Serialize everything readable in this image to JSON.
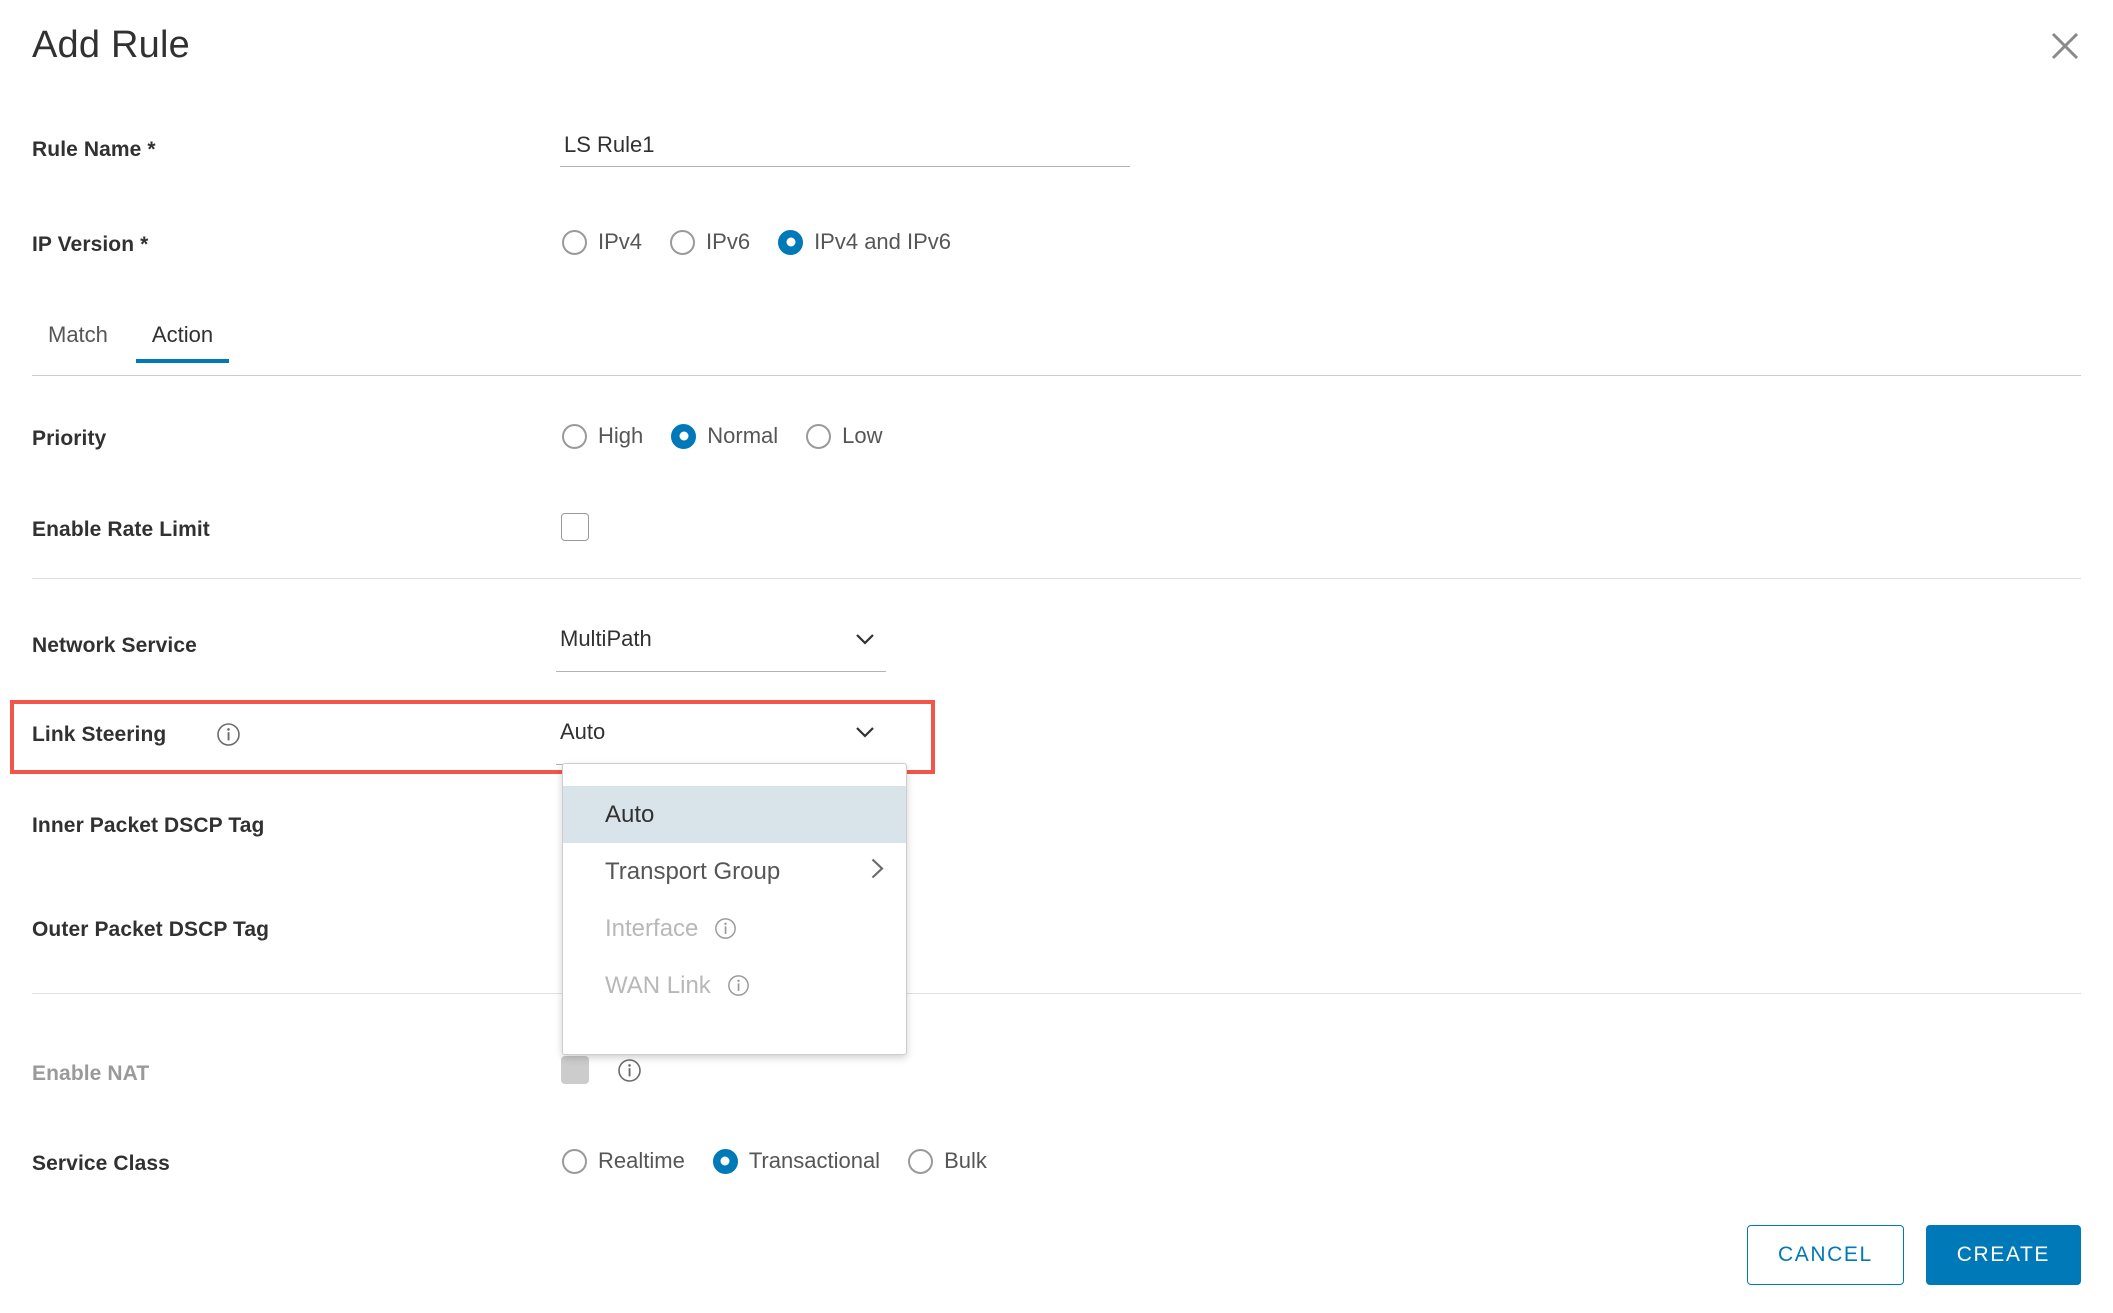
{
  "dialog": {
    "title": "Add Rule",
    "close_icon": "close-icon"
  },
  "fields": {
    "rule_name": {
      "label": "Rule Name *",
      "value": "LS Rule1",
      "placeholder": ""
    },
    "ip_version": {
      "label": "IP Version *",
      "options": [
        "IPv4",
        "IPv6",
        "IPv4 and IPv6"
      ],
      "selected": "IPv4 and IPv6"
    },
    "priority": {
      "label": "Priority",
      "options": [
        "High",
        "Normal",
        "Low"
      ],
      "selected": "Normal"
    },
    "enable_rate_limit": {
      "label": "Enable Rate Limit",
      "checked": false
    },
    "network_service": {
      "label": "Network Service",
      "value": "MultiPath"
    },
    "link_steering": {
      "label": "Link Steering",
      "value": "Auto",
      "info_icon": "info-icon",
      "highlighted": true
    },
    "inner_dscp": {
      "label": "Inner Packet DSCP Tag"
    },
    "outer_dscp": {
      "label": "Outer Packet DSCP Tag"
    },
    "enable_nat": {
      "label": "Enable NAT",
      "checked": false,
      "disabled": true,
      "info_icon": "info-icon"
    },
    "service_class": {
      "label": "Service Class",
      "options": [
        "Realtime",
        "Transactional",
        "Bulk"
      ],
      "selected": "Transactional"
    }
  },
  "tabs": [
    {
      "label": "Match",
      "active": false
    },
    {
      "label": "Action",
      "active": true
    }
  ],
  "link_steering_dropdown": {
    "open": true,
    "items": [
      {
        "label": "Auto",
        "selected": true,
        "disabled": false,
        "submenu": false,
        "info": false
      },
      {
        "label": "Transport Group",
        "selected": false,
        "disabled": false,
        "submenu": true,
        "info": false
      },
      {
        "label": "Interface",
        "selected": false,
        "disabled": true,
        "submenu": false,
        "info": true
      },
      {
        "label": "WAN Link",
        "selected": false,
        "disabled": true,
        "submenu": false,
        "info": true
      }
    ]
  },
  "footer": {
    "cancel_label": "CANCEL",
    "create_label": "CREATE"
  },
  "colors": {
    "accent": "#0079b8",
    "highlight": "#f4554a",
    "text": "#313131",
    "muted": "#565656",
    "disabled": "#9a9a9a",
    "menu_selected_bg": "#d9e4ea"
  }
}
